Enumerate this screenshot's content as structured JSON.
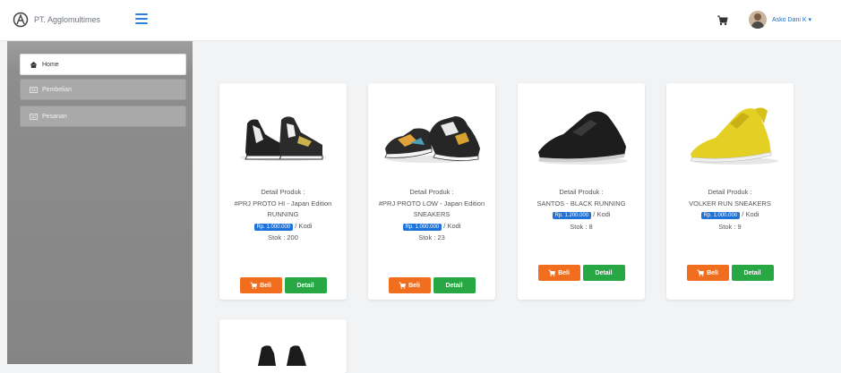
{
  "app": {
    "brand_name": "PT. Agglomultimes"
  },
  "header": {
    "user_name": "Asko Dani K ▾"
  },
  "sidebar": {
    "items": [
      {
        "label": "Home",
        "active": true,
        "icon": "home-icon"
      },
      {
        "label": "Pembelian",
        "active": false,
        "icon": "list-icon"
      },
      {
        "label": "Pesanan",
        "active": false,
        "icon": "list-icon"
      }
    ]
  },
  "products": [
    {
      "desc_prefix": "Detail Produk :",
      "name": "#PRJ PROTO HI - Japan Edition RUNNING",
      "price": "Rp. 1.000.000",
      "unit": "/ Kodi",
      "stock": "Stok : 200",
      "buy_label": "Beli",
      "detail_label": "Detail",
      "image": "hi-top-sneaker-black-white"
    },
    {
      "desc_prefix": "Detail Produk :",
      "name": "#PRJ PROTO LOW - Japan Edition SNEAKERS",
      "price": "Rp. 1.000.000",
      "unit": "/ Kodi",
      "stock": "Stok : 23",
      "buy_label": "Beli",
      "detail_label": "Detail",
      "image": "low-sneaker-multicolor"
    },
    {
      "desc_prefix": "Detail Produk :",
      "name": "SANTOS - BLACK RUNNING",
      "price": "Rp. 1.200.000",
      "unit": "/ Kodi",
      "stock": "Stok : 8",
      "buy_label": "Beli",
      "detail_label": "Detail",
      "image": "black-sneaker"
    },
    {
      "desc_prefix": "Detail Produk :",
      "name": "VOLKER RUN SNEAKERS",
      "price": "Rp. 1.000.000",
      "unit": "/ Kodi",
      "stock": "Stok : 9",
      "buy_label": "Beli",
      "detail_label": "Detail",
      "image": "yellow-sneaker"
    },
    {
      "image": "black-boot-partial"
    }
  ],
  "colors": {
    "accent": "#1f73d6",
    "buy": "#f06e1d",
    "detail": "#28a745",
    "sidebar": "#8d8d8d"
  }
}
